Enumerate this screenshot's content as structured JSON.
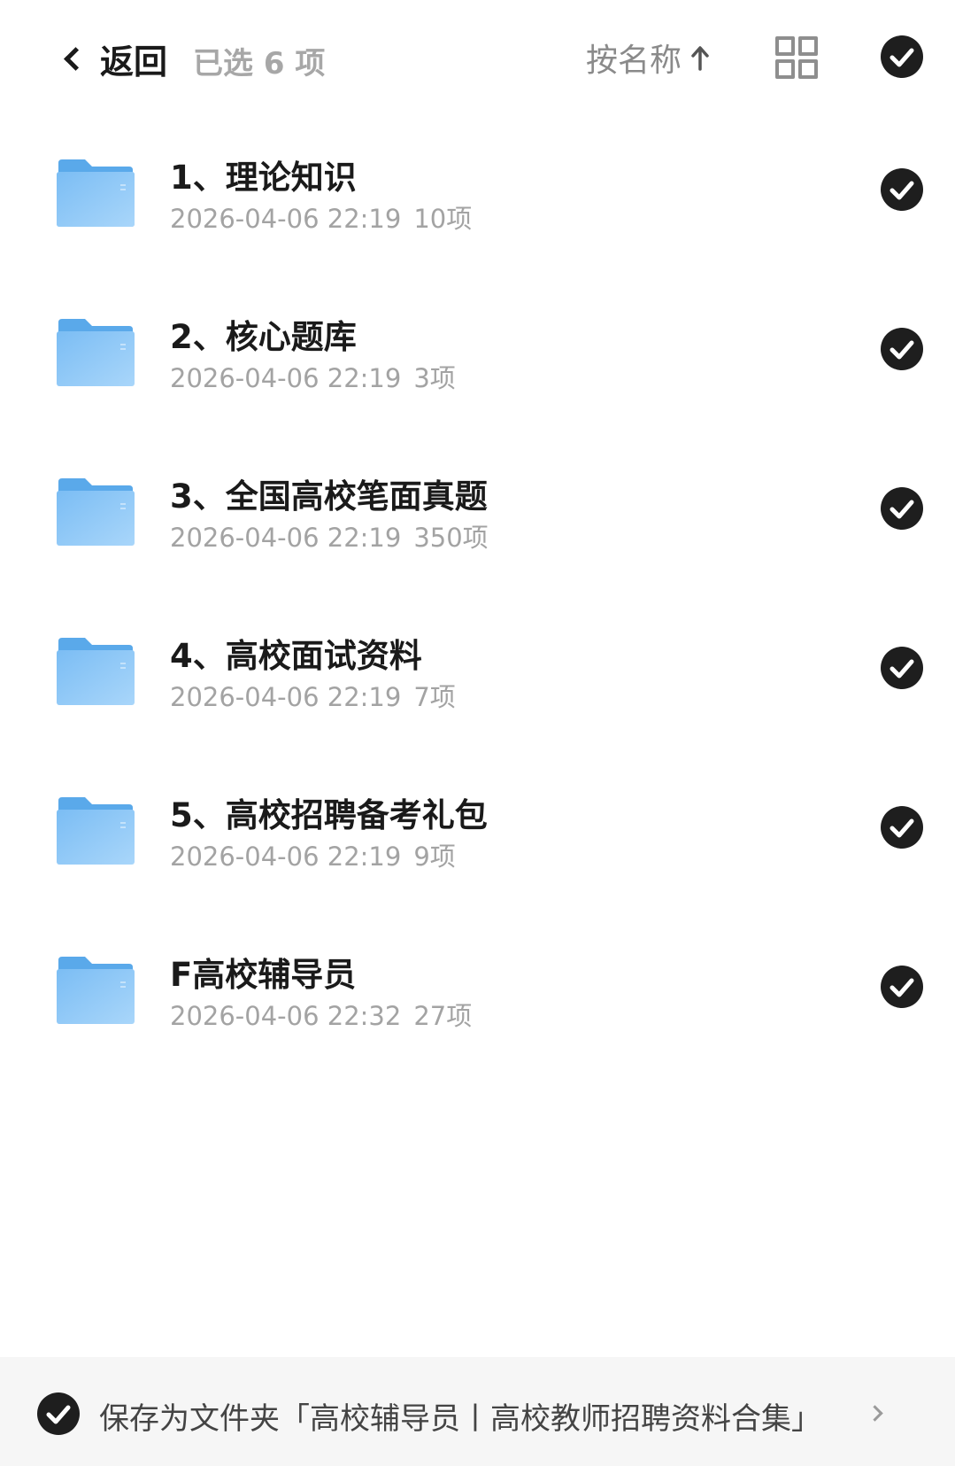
{
  "header": {
    "back_label": "返回",
    "selected_label": "已选 6 项",
    "sort_label": "按名称",
    "sort_direction_icon": "arrow-up-icon",
    "view_toggle_icon": "grid-view-icon",
    "select_all_checked": true
  },
  "colors": {
    "check_fill": "#1e1e1e",
    "folder_blue": "#6cb7f3",
    "meta_text": "#a3a3a3",
    "footer_bg": "#f6f6f6"
  },
  "folders": [
    {
      "name": "1、理论知识",
      "date": "2026-04-06 22:19",
      "count": "10项",
      "checked": true
    },
    {
      "name": "2、核心题库",
      "date": "2026-04-06 22:19",
      "count": "3项",
      "checked": true
    },
    {
      "name": "3、全国高校笔面真题",
      "date": "2026-04-06 22:19",
      "count": "350项",
      "checked": true
    },
    {
      "name": "4、高校面试资料",
      "date": "2026-04-06 22:19",
      "count": "7项",
      "checked": true
    },
    {
      "name": "5、高校招聘备考礼包",
      "date": "2026-04-06 22:19",
      "count": "9项",
      "checked": true
    },
    {
      "name": "F高校辅导员",
      "date": "2026-04-06 22:32",
      "count": "27项",
      "checked": true
    }
  ],
  "footer": {
    "save_text": "保存为文件夹「高校辅导员丨高校教师招聘资料合集」",
    "checked": true
  }
}
